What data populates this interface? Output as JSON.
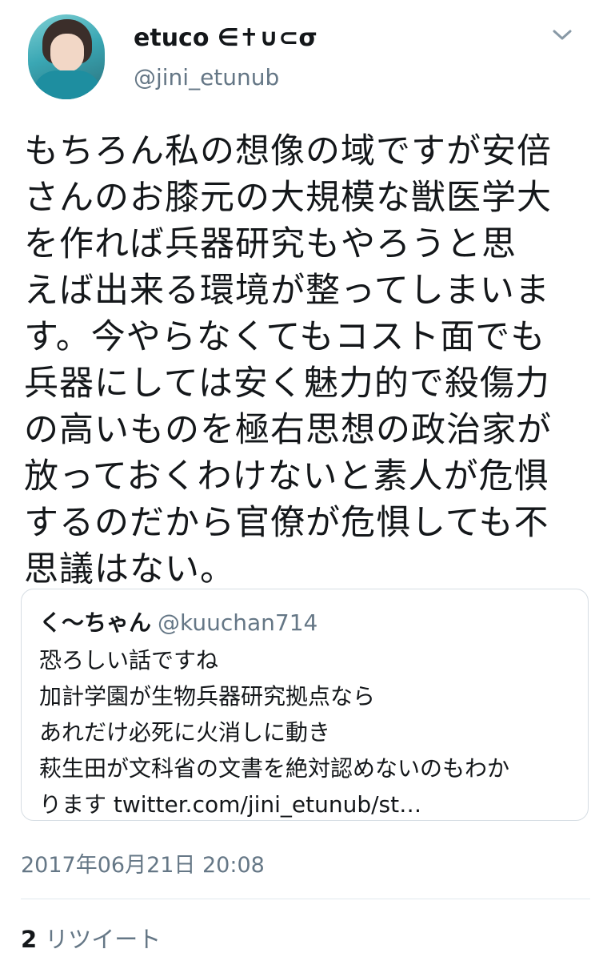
{
  "author": {
    "display_name": "etuco ∈✝∪⊂σ",
    "username": "@jini_etunub"
  },
  "tweet": {
    "text_lines": [
      "もちろん私の想像の域ですが安倍",
      "さんのお膝元の大規模な獣医学大",
      "を作れば兵器研究もやろうと思",
      "えば出来る環境が整ってしまいま",
      "す。今やらなくてもコスト面でも",
      "兵器にしては安く魅力的で殺傷力",
      "の高いものを極右思想の政治家が",
      "放っておくわけないと素人が危惧",
      "するのだから官僚が危惧しても不",
      "思議はない。"
    ],
    "timestamp": "2017年06月21日 20:08"
  },
  "quote": {
    "name": "く〜ちゃん",
    "handle": "@kuuchan714",
    "lines": [
      "恐ろしい話ですね",
      "加計学園が生物兵器研究拠点なら",
      "あれだけ必死に火消しに動き",
      "萩生田が文科省の文書を絶対認めないのもわか",
      "ります twitter.com/jini_etunub/st…"
    ]
  },
  "stats": {
    "retweet_count": "2",
    "retweet_label": "リツイート"
  },
  "icons": {
    "menu": "chevron-down-icon"
  },
  "colors": {
    "text": "#14171a",
    "secondary": "#657786",
    "border": "#d6dde3"
  }
}
